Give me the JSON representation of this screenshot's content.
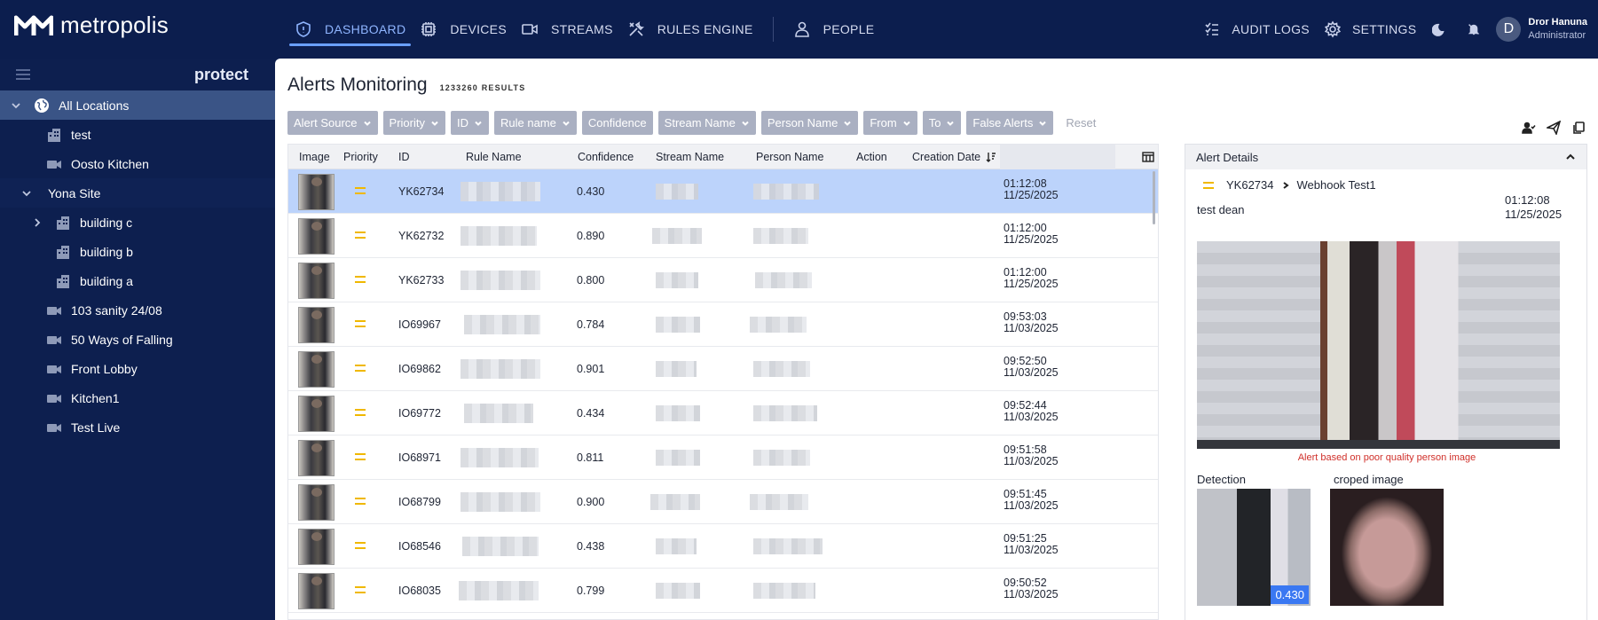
{
  "brand": {
    "name": "metropolis"
  },
  "nav": {
    "items": [
      {
        "label": "DASHBOARD",
        "icon": "shield-icon",
        "active": true
      },
      {
        "label": "DEVICES",
        "icon": "chip-icon"
      },
      {
        "label": "STREAMS",
        "icon": "video-icon"
      },
      {
        "label": "RULES ENGINE",
        "icon": "tools-icon"
      },
      {
        "label": "PEOPLE",
        "icon": "person-icon"
      }
    ],
    "audit_label": "AUDIT LOGS",
    "settings_label": "SETTINGS",
    "user": {
      "initial": "D",
      "name": "Dror Hanuna",
      "role": "Administrator"
    }
  },
  "sidebar": {
    "title": "protect",
    "items": [
      {
        "label": "All Locations",
        "type": "globe"
      },
      {
        "label": "test",
        "type": "building"
      },
      {
        "label": "Oosto Kitchen",
        "type": "camera"
      },
      {
        "label": "Yona Site",
        "type": "site"
      },
      {
        "label": "building c",
        "type": "building"
      },
      {
        "label": "building b",
        "type": "building"
      },
      {
        "label": "building a",
        "type": "building"
      },
      {
        "label": "103 sanity 24/08",
        "type": "camera"
      },
      {
        "label": "50 Ways of Falling",
        "type": "camera"
      },
      {
        "label": "Front Lobby",
        "type": "camera"
      },
      {
        "label": "Kitchen1",
        "type": "camera"
      },
      {
        "label": "Test Live",
        "type": "camera"
      }
    ]
  },
  "main": {
    "title": "Alerts Monitoring",
    "results": "1233260 RESULTS",
    "filters": [
      "Alert Source",
      "Priority",
      "ID",
      "Rule name",
      "Confidence",
      "Stream Name",
      "Person Name",
      "From",
      "To",
      "False Alerts"
    ],
    "reset_label": "Reset",
    "columns": [
      "Image",
      "Priority",
      "ID",
      "Rule Name",
      "Confidence",
      "Stream Name",
      "Person Name",
      "Action",
      "Creation Date"
    ],
    "rows": [
      {
        "id": "YK62734",
        "confidence": "0.430",
        "time": "01:12:08",
        "date": "11/25/2025"
      },
      {
        "id": "YK62732",
        "confidence": "0.890",
        "time": "01:12:00",
        "date": "11/25/2025"
      },
      {
        "id": "YK62733",
        "confidence": "0.800",
        "time": "01:12:00",
        "date": "11/25/2025"
      },
      {
        "id": "IO69967",
        "confidence": "0.784",
        "time": "09:53:03",
        "date": "11/03/2025"
      },
      {
        "id": "IO69862",
        "confidence": "0.901",
        "time": "09:52:50",
        "date": "11/03/2025"
      },
      {
        "id": "IO69772",
        "confidence": "0.434",
        "time": "09:52:44",
        "date": "11/03/2025"
      },
      {
        "id": "IO68971",
        "confidence": "0.811",
        "time": "09:51:58",
        "date": "11/03/2025"
      },
      {
        "id": "IO68799",
        "confidence": "0.900",
        "time": "09:51:45",
        "date": "11/03/2025"
      },
      {
        "id": "IO68546",
        "confidence": "0.438",
        "time": "09:51:25",
        "date": "11/03/2025"
      },
      {
        "id": "IO68035",
        "confidence": "0.799",
        "time": "09:50:52",
        "date": "11/03/2025"
      }
    ]
  },
  "details": {
    "header": "Alert Details",
    "alert_id": "YK62734",
    "rule": "Webhook Test1",
    "description": "test dean",
    "time": "01:12:08",
    "date": "11/25/2025",
    "warning": "Alert based on poor quality person image",
    "detection_label": "Detection",
    "cropped_label": "croped image",
    "score": "0.430"
  },
  "colors": {
    "priority": "#f0b800",
    "accent": "#6aa0ff",
    "selected_row": "#bcd3fb"
  }
}
